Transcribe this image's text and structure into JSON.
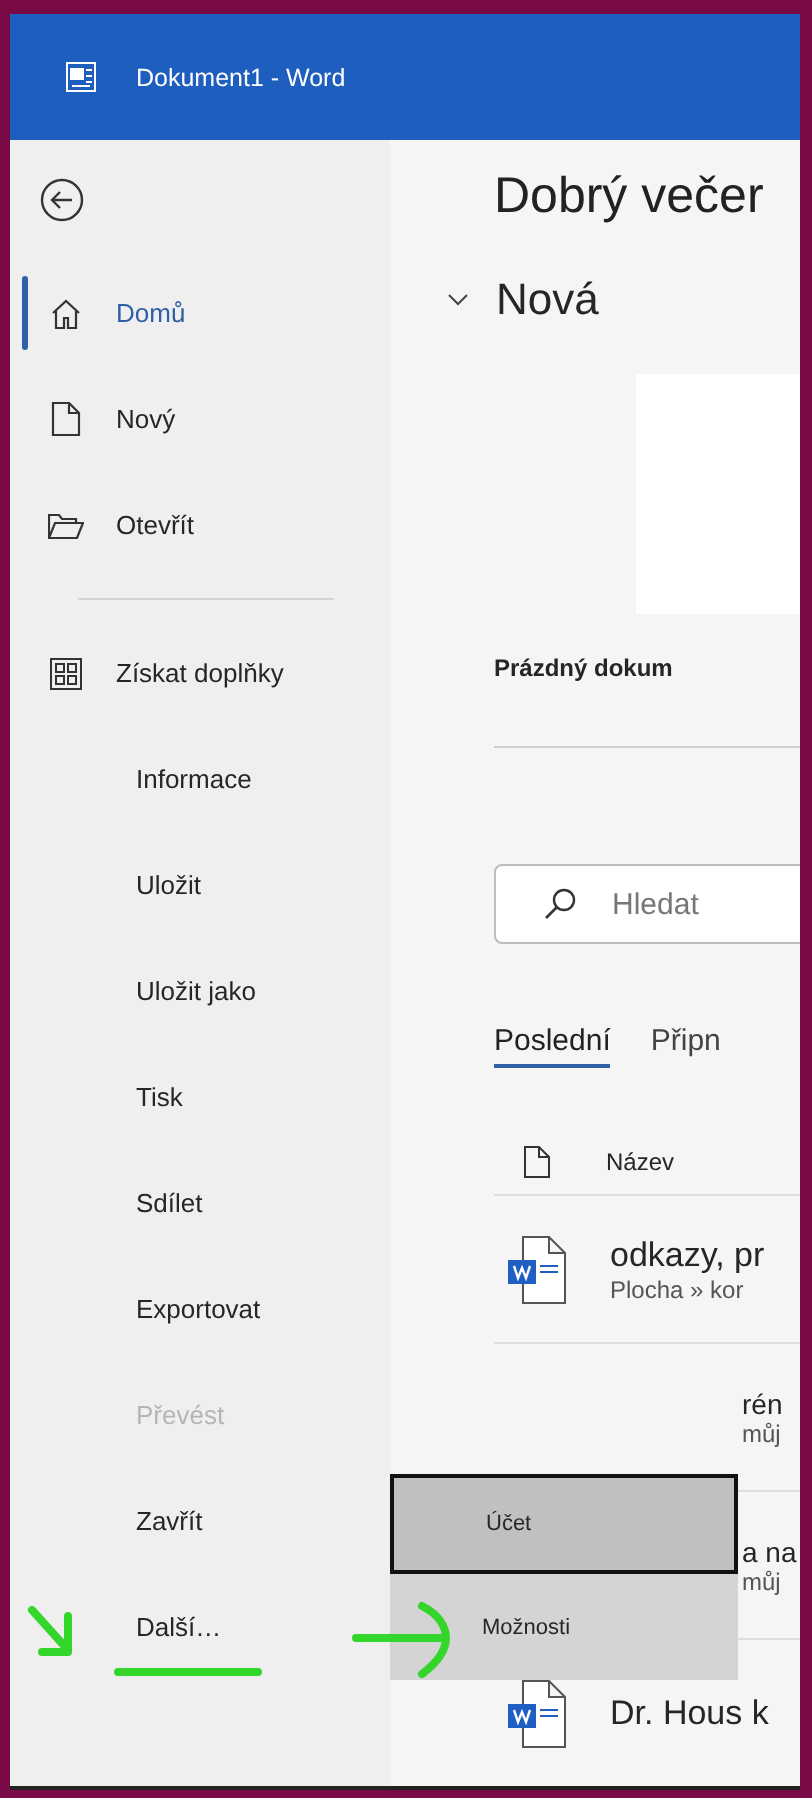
{
  "window": {
    "title": "Dokument1 - Word"
  },
  "sidebar": {
    "top_items": [
      {
        "label": "Domů",
        "selected": true
      },
      {
        "label": "Nový",
        "selected": false
      },
      {
        "label": "Otevřít",
        "selected": false
      }
    ],
    "addins": {
      "label": "Získat doplňky"
    },
    "items": [
      {
        "label": "Informace",
        "disabled": false
      },
      {
        "label": "Uložit",
        "disabled": false
      },
      {
        "label": "Uložit jako",
        "disabled": false
      },
      {
        "label": "Tisk",
        "disabled": false
      },
      {
        "label": "Sdílet",
        "disabled": false
      },
      {
        "label": "Exportovat",
        "disabled": false
      },
      {
        "label": "Převést",
        "disabled": true
      },
      {
        "label": "Zavřít",
        "disabled": false
      },
      {
        "label": "Další…",
        "disabled": false
      }
    ]
  },
  "main": {
    "greeting": "Dobrý večer",
    "new_section": {
      "title": "Nová",
      "expanded": true,
      "templates": [
        {
          "caption": "Prázdný dokum"
        }
      ]
    },
    "search": {
      "placeholder": "Hledat"
    },
    "tabs": [
      {
        "label": "Poslední",
        "selected": true
      },
      {
        "label": "Připn",
        "selected": false
      }
    ],
    "files": {
      "column": "Název",
      "rows": [
        {
          "kind": "full",
          "name": "odkazy, pr",
          "path": "Plocha » kor"
        },
        {
          "kind": "covered",
          "name": "rén",
          "path": "můj"
        },
        {
          "kind": "covered",
          "name": "a na",
          "path": "můj"
        },
        {
          "kind": "full",
          "name": "Dr. Hous k"
        }
      ]
    }
  },
  "popup_menu": [
    {
      "label": "Účet",
      "selected": true
    },
    {
      "label": "Možnosti",
      "selected": false
    }
  ]
}
